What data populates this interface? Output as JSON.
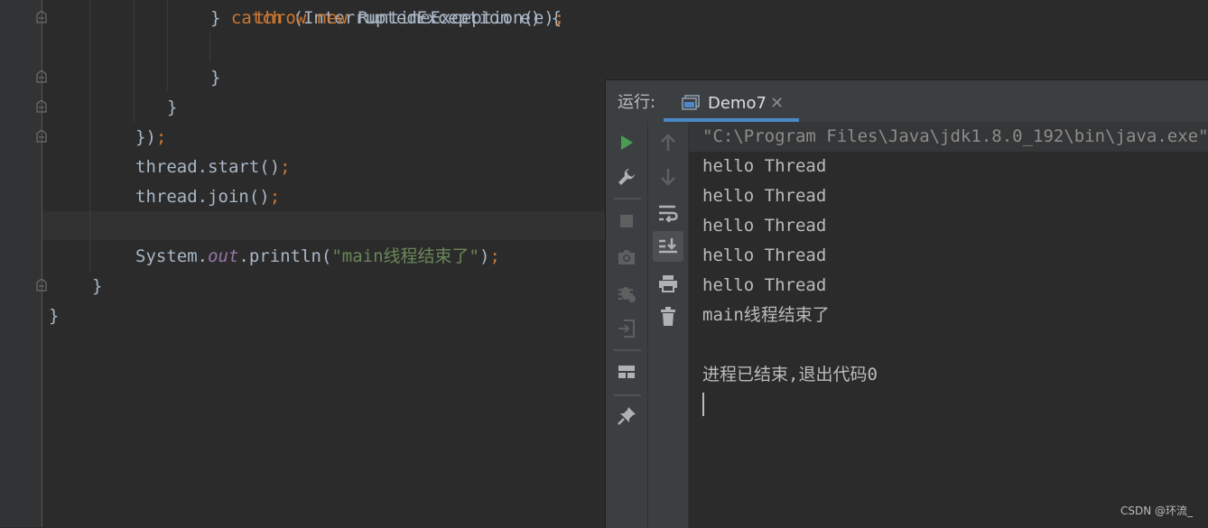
{
  "editor": {
    "lines": [
      {
        "indent": "        ",
        "parts": [
          {
            "t": "} ",
            "c": "plain"
          },
          {
            "t": "catch",
            "c": "kw"
          },
          {
            "t": " (InterruptedException e) {",
            "c": "plain"
          }
        ]
      },
      {
        "indent": "            ",
        "parts": [
          {
            "t": "throw",
            "c": "kw"
          },
          {
            "t": " ",
            "c": "plain"
          },
          {
            "t": "new",
            "c": "kw"
          },
          {
            "t": " RuntimeException(e)",
            "c": "plain"
          },
          {
            "t": ";",
            "c": "punc"
          }
        ]
      },
      {
        "indent": "        ",
        "parts": [
          {
            "t": "}",
            "c": "plain"
          }
        ]
      },
      {
        "indent": "    ",
        "parts": [
          {
            "t": "}",
            "c": "plain"
          }
        ]
      },
      {
        "indent": "",
        "parts": [
          {
            "t": "})",
            "c": "plain"
          },
          {
            "t": ";",
            "c": "punc"
          }
        ]
      },
      {
        "indent": "",
        "parts": [
          {
            "t": "thread.start()",
            "c": "plain"
          },
          {
            "t": ";",
            "c": "punc"
          }
        ]
      },
      {
        "indent": "",
        "parts": [
          {
            "t": "thread.join()",
            "c": "plain"
          },
          {
            "t": ";",
            "c": "punc"
          }
        ]
      },
      {
        "indent": "",
        "parts": []
      },
      {
        "indent": "",
        "parts": [
          {
            "t": "System.",
            "c": "plain"
          },
          {
            "t": "out",
            "c": "fld"
          },
          {
            "t": ".println(",
            "c": "plain"
          },
          {
            "t": "\"main线程结束了\"",
            "c": "str"
          },
          {
            "t": ")",
            "c": "plain"
          },
          {
            "t": ";",
            "c": "punc"
          }
        ]
      },
      {
        "indent": "",
        "parts": [
          {
            "t": "}",
            "c": "plain"
          }
        ]
      },
      {
        "indent": "",
        "parts": [
          {
            "t": "}",
            "c": "plain"
          }
        ]
      }
    ]
  },
  "run_panel": {
    "label": "运行:",
    "tab": {
      "label": "Demo7",
      "close": "✕"
    },
    "toolbar_left": [
      "rerun-icon",
      "wrench-icon",
      "stop-icon",
      "camera-icon",
      "debug-bug-icon",
      "exit-icon",
      "layout-icon",
      "pin-icon"
    ],
    "toolbar_right": [
      "up-arrow-icon",
      "down-arrow-icon",
      "soft-wrap-icon",
      "scroll-to-end-icon",
      "print-icon",
      "trash-icon"
    ],
    "console": {
      "command": "\"C:\\Program Files\\Java\\jdk1.8.0_192\\bin\\java.exe\"",
      "output": [
        "hello Thread",
        "hello Thread",
        "hello Thread",
        "hello Thread",
        "hello Thread",
        "main线程结束了",
        "",
        "进程已结束,退出代码0"
      ]
    }
  },
  "watermark": "CSDN @环流_",
  "colors": {
    "keyword": "#cc7832",
    "string": "#6a8759",
    "field": "#9876aa",
    "text": "#a9b7c6",
    "accent": "#4a88c7",
    "run": "#499c54"
  }
}
